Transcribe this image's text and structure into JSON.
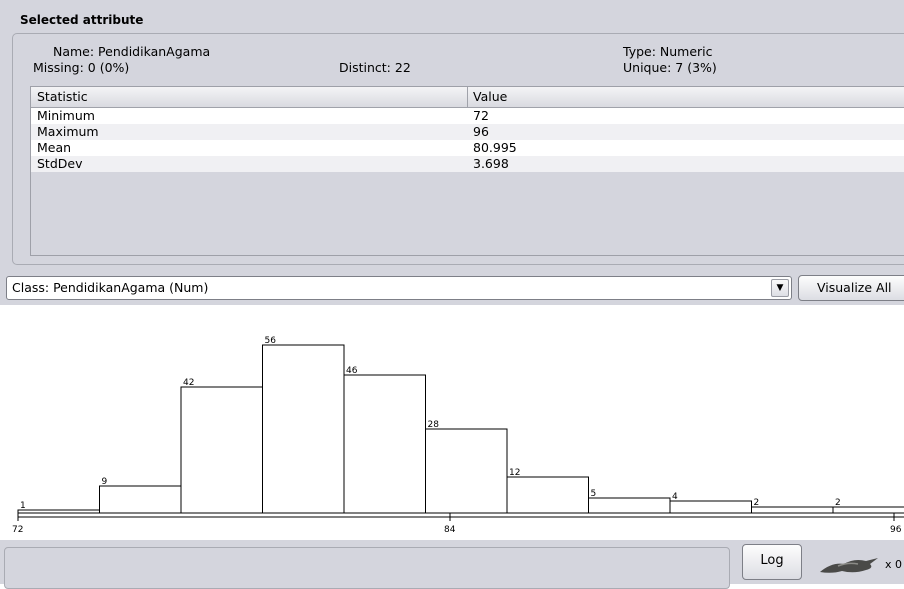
{
  "selected_attribute": {
    "title": "Selected attribute",
    "name": "Name: PendidikanAgama",
    "type": "Type: Numeric",
    "missing": "Missing: 0 (0%)",
    "distinct": "Distinct: 22",
    "unique": "Unique: 7 (3%)"
  },
  "stats_table": {
    "headers": [
      "Statistic",
      "Value"
    ],
    "rows": [
      {
        "stat": "Minimum",
        "value": "72"
      },
      {
        "stat": "Maximum",
        "value": "96"
      },
      {
        "stat": "Mean",
        "value": "80.995"
      },
      {
        "stat": "StdDev",
        "value": "3.698"
      }
    ]
  },
  "class_selector": {
    "label": "Class: PendidikanAgama (Num)"
  },
  "visualize_button": "Visualize All",
  "log_button": "Log",
  "status_suffix": "x 0",
  "chart_data": {
    "type": "bar",
    "values": [
      1,
      9,
      42,
      56,
      46,
      28,
      12,
      5,
      4,
      2,
      2
    ],
    "x_ticks": [
      "72",
      "84",
      "96"
    ],
    "bar_fill": "#ffffff",
    "bar_stroke": "#000000"
  }
}
